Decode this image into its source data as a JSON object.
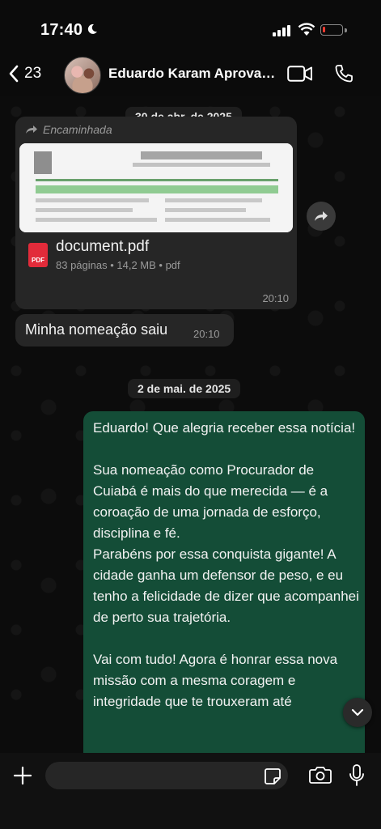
{
  "status_bar": {
    "time": "17:40",
    "battery_level": 0.15
  },
  "header": {
    "back_count": "23",
    "contact_name": "Eduardo Karam Aprovad..."
  },
  "messages": {
    "date_1": "30 de abr. de 2025",
    "doc": {
      "forwarded_label": "Encaminhada",
      "file_name": "document.pdf",
      "file_type_badge": "PDF",
      "meta": "83 páginas • 14,2 MB • pdf",
      "time": "20:10"
    },
    "text_1": {
      "text": "Minha nomeação saiu",
      "time": "20:10"
    },
    "date_2": "2 de mai. de 2025",
    "outgoing": {
      "text": "Eduardo! Que alegria receber essa notícia!\n\nSua nomeação como Procurador de Cuiabá é mais do que merecida — é a coroação de uma jornada de esforço, disciplina e fé.\nParabéns por essa conquista gigante! A cidade ganha um defensor de peso, e eu tenho a felicidade de dizer que acompanhei de perto sua trajetória.\n\nVai com tudo! Agora é honrar essa nova missão com a mesma coragem e integridade que te trouxeram até"
    }
  },
  "input": {
    "placeholder": ""
  },
  "colors": {
    "outgoing_bubble": "#144d37",
    "incoming_bubble": "#262626",
    "background": "#0b0b0b"
  }
}
